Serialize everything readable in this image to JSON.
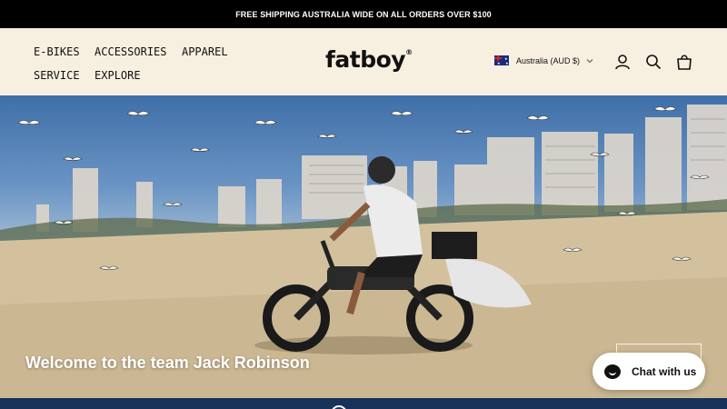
{
  "announcement": {
    "text": "FREE SHIPPING AUSTRALIA WIDE ON ALL ORDERS OVER $100"
  },
  "header": {
    "nav": [
      {
        "label": "E-BIKES"
      },
      {
        "label": "ACCESSORIES"
      },
      {
        "label": "APPAREL"
      },
      {
        "label": "SERVICE"
      },
      {
        "label": "EXPLORE"
      }
    ],
    "logo": "fatboy",
    "logo_mark": "®",
    "country": {
      "label": "Australia (AUD $)",
      "flag": "australia-flag-icon"
    },
    "icons": [
      "account-icon",
      "search-icon",
      "cart-icon"
    ]
  },
  "hero": {
    "title": "Welcome to the team Jack Robinson",
    "scene": "rider on fat-tyre e-bike on beach with seagulls and high-rise buildings"
  },
  "chat": {
    "label": "Chat with us"
  },
  "colors": {
    "announcement_bg": "#000000",
    "header_bg": "#f7efe0",
    "footer_band": "#18325a",
    "text": "#111111"
  }
}
